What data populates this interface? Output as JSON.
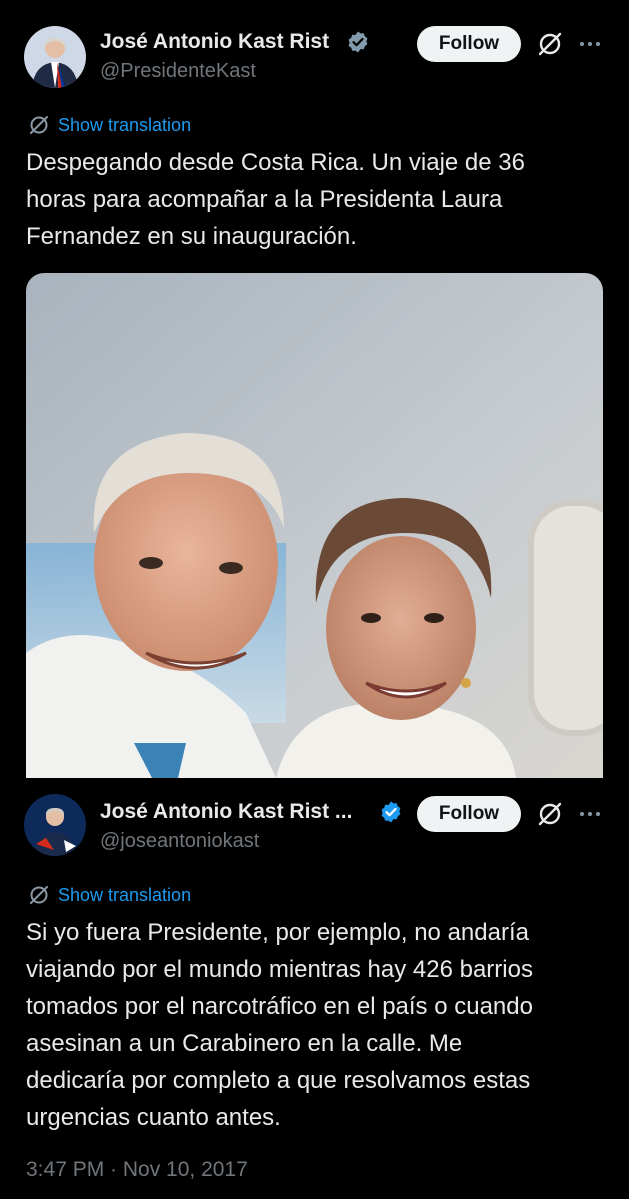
{
  "main_tweet": {
    "author_name": "José Antonio Kast Rist",
    "author_handle": "@PresidenteKast",
    "follow_label": "Follow",
    "translate_label": "Show translation",
    "text": "Despegando desde Costa Rica. Un viaje de 36\nhoras para acompañar a la Presidenta Laura\nFernandez en su inauguración."
  },
  "quoted_tweet": {
    "author_name": "José Antonio Kast Rist ...",
    "author_handle": "@joseantoniokast",
    "follow_label": "Follow",
    "translate_label": "Show translation",
    "text": "Si yo fuera Presidente, por ejemplo, no andaría\nviajando por el mundo mientras hay 426 barrios\ntomados por el narcotráfico en el país o cuando\nasesinan a un Carabinero en la calle. Me\ndedicaría por completo a que resolvamos estas\nurgencias cuanto antes.",
    "timestamp": "3:47 PM · Nov 10, 2017"
  },
  "icons": {
    "verified": "verified-badge-icon",
    "grok": "grok-icon",
    "more": "more-options-icon",
    "translate": "translate-icon"
  },
  "colors": {
    "background": "#000000",
    "text": "#e7e9ea",
    "muted": "#71767b",
    "accent": "#1d9bf0",
    "button_bg": "#eff3f4"
  }
}
